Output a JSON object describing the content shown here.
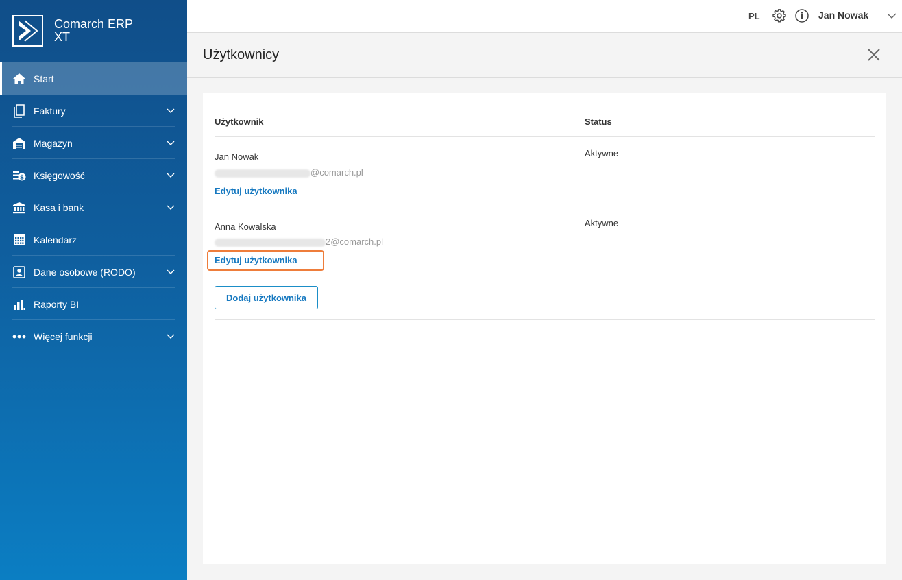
{
  "app": {
    "name": "Comarch ERP XT"
  },
  "sidebar": {
    "items": [
      {
        "label": "Start",
        "icon": "home-icon",
        "active": true,
        "expandable": false
      },
      {
        "label": "Faktury",
        "icon": "document-icon",
        "active": false,
        "expandable": true
      },
      {
        "label": "Magazyn",
        "icon": "warehouse-icon",
        "active": false,
        "expandable": true
      },
      {
        "label": "Księgowość",
        "icon": "accounting-icon",
        "active": false,
        "expandable": true
      },
      {
        "label": "Kasa i bank",
        "icon": "bank-icon",
        "active": false,
        "expandable": true
      },
      {
        "label": "Kalendarz",
        "icon": "calendar-icon",
        "active": false,
        "expandable": false
      },
      {
        "label": "Dane osobowe (RODO)",
        "icon": "person-card-icon",
        "active": false,
        "expandable": true
      },
      {
        "label": "Raporty BI",
        "icon": "bar-chart-icon",
        "active": false,
        "expandable": false
      },
      {
        "label": "Więcej funkcji",
        "icon": "more-dots-icon",
        "active": false,
        "expandable": true
      }
    ]
  },
  "topbar": {
    "language": "PL",
    "user_name": "Jan Nowak"
  },
  "page": {
    "title": "Użytkownicy"
  },
  "table": {
    "columns": [
      "Użytkownik",
      "Status"
    ],
    "rows": [
      {
        "name": "Jan Nowak",
        "email": "@comarch.pl",
        "status": "Aktywne",
        "edit_label": "Edytuj użytkownika"
      },
      {
        "name": "Anna Kowalska",
        "email": "2@comarch.pl",
        "status": "Aktywne",
        "edit_label": "Edytuj użytkownika"
      }
    ],
    "add_button_label": "Dodaj użytkownika"
  },
  "colors": {
    "sidebar_top": "#104e89",
    "sidebar_bottom": "#0b7ec3",
    "link": "#1779c0",
    "highlight": "#ee7d3b"
  }
}
